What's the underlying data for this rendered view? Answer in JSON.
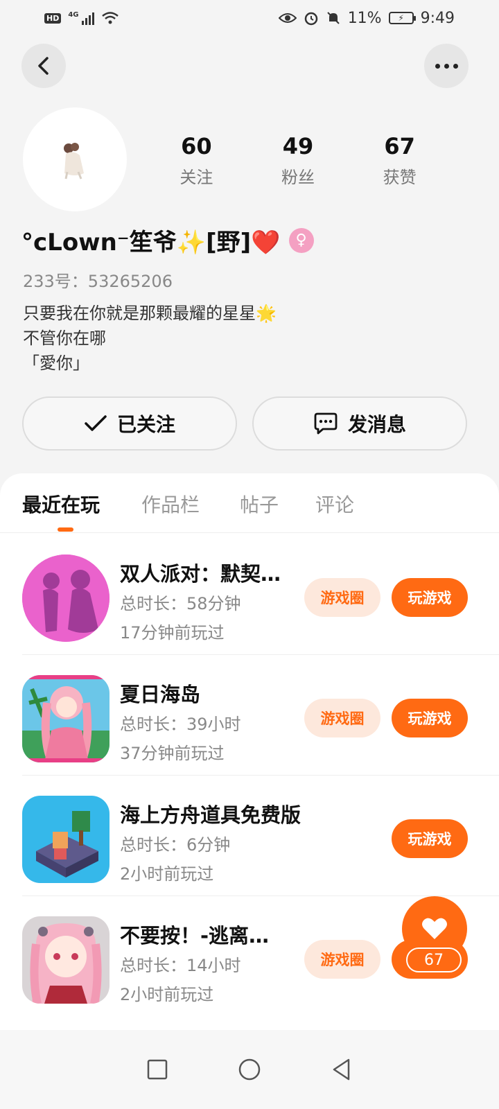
{
  "status_bar": {
    "network": "4G",
    "battery": "11%",
    "time": "9:49"
  },
  "profile": {
    "nickname": "°cLown⁻笙爷✨[野]❤️",
    "account_id": "233号：53265206",
    "bio": [
      "只要我在你就是那颗最耀的星星🌟",
      "不管你在哪",
      "「愛你」"
    ],
    "stats": [
      {
        "value": "60",
        "label": "关注"
      },
      {
        "value": "49",
        "label": "粉丝"
      },
      {
        "value": "67",
        "label": "获赞"
      }
    ]
  },
  "actions": {
    "follow_label": "已关注",
    "message_label": "发消息"
  },
  "tabs": [
    "最近在玩",
    "作品栏",
    "帖子",
    "评论"
  ],
  "games": [
    {
      "title": "双人派对：默契…",
      "duration": "总时长：58分钟",
      "last_played": "17分钟前玩过",
      "circle_label": "游戏圈",
      "play_label": "玩游戏"
    },
    {
      "title": "夏日海岛",
      "duration": "总时长：39小时",
      "last_played": "37分钟前玩过",
      "circle_label": "游戏圈",
      "play_label": "玩游戏"
    },
    {
      "title": "海上方舟道具免费版",
      "duration": "总时长：6分钟",
      "last_played": "2小时前玩过",
      "play_label": "玩游戏"
    },
    {
      "title": "不要按！-逃离…",
      "duration": "总时长：14小时",
      "last_played": "2小时前玩过",
      "circle_label": "游戏圈",
      "play_label": "玩游戏"
    }
  ],
  "like_fab": {
    "count": "67"
  },
  "colors": {
    "accent": "#ff6a13",
    "accent_light": "#fde8dc",
    "gender_badge": "#f4a0c2"
  }
}
